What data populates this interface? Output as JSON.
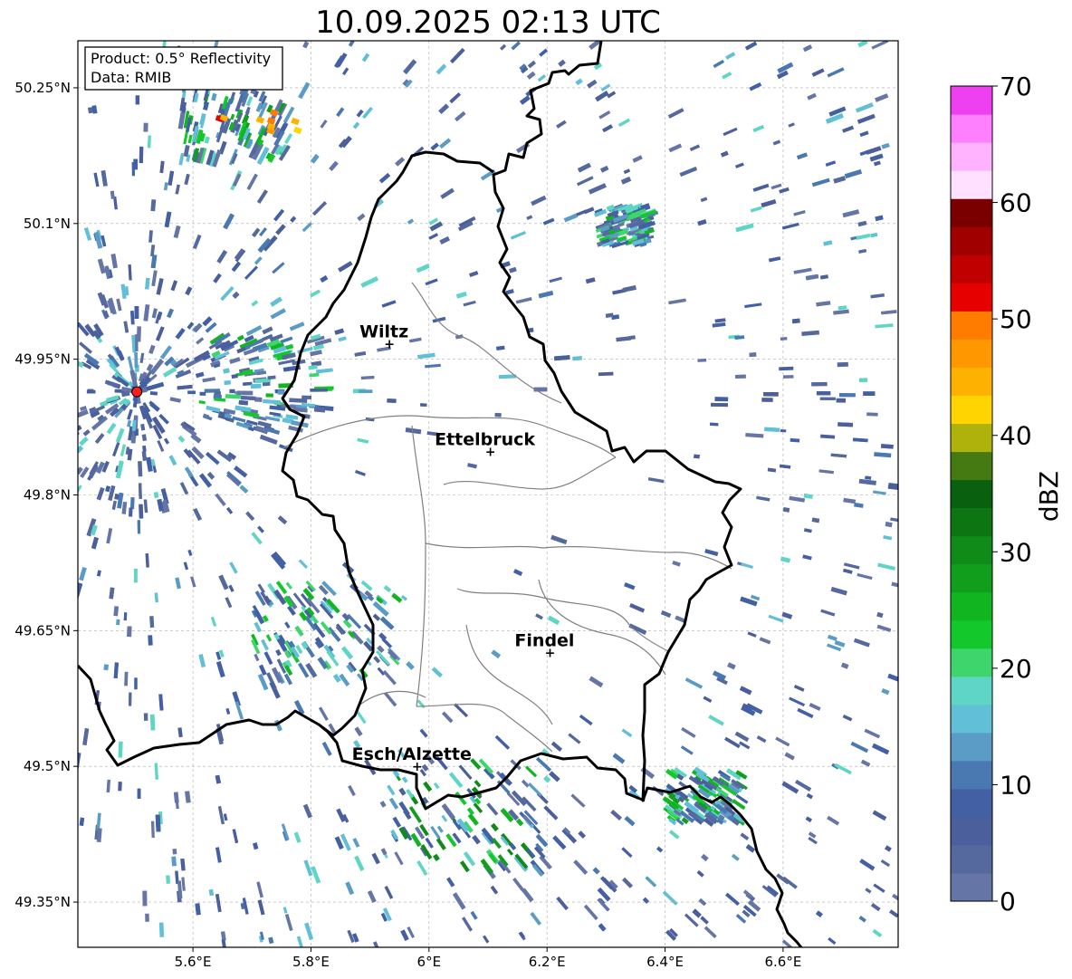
{
  "title": "10.09.2025 02:13 UTC",
  "info_box": {
    "product_line": "Product: 0.5° Reflectivity",
    "data_line": "Data: RMIB"
  },
  "x_ticks": [
    "5.6°E",
    "5.8°E",
    "6°E",
    "6.2°E",
    "6.4°E",
    "6.6°E"
  ],
  "x_tick_values": [
    5.6,
    5.8,
    6.0,
    6.2,
    6.4,
    6.6
  ],
  "y_ticks": [
    "50.25°N",
    "50.1°N",
    "49.95°N",
    "49.8°N",
    "49.65°N",
    "49.5°N",
    "49.35°N"
  ],
  "y_tick_values": [
    50.25,
    50.1,
    49.95,
    49.8,
    49.65,
    49.5,
    49.35
  ],
  "lon_range": [
    5.405,
    6.795
  ],
  "lat_range": [
    49.3,
    50.302
  ],
  "radar_site": {
    "lon": 5.505,
    "lat": 49.914,
    "color": "#ff1f1f"
  },
  "cities": [
    {
      "name": "Wiltz",
      "lon": 5.933,
      "lat": 49.967
    },
    {
      "name": "Ettelbruck",
      "lon": 6.104,
      "lat": 49.848
    },
    {
      "name": "Findel",
      "lon": 6.205,
      "lat": 49.626
    },
    {
      "name": "Esch/Alzette",
      "lon": 5.98,
      "lat": 49.5
    }
  ],
  "colorbar": {
    "label": "dBZ",
    "min": 0,
    "max": 70,
    "tick_labels": [
      "0",
      "10",
      "20",
      "30",
      "40",
      "50",
      "60",
      "70"
    ],
    "tick_values": [
      0,
      10,
      20,
      30,
      40,
      50,
      60,
      70
    ],
    "colors": [
      "#6475a6",
      "#55699e",
      "#4a5f9b",
      "#4460a5",
      "#4a78b0",
      "#5a9cc6",
      "#62bfd8",
      "#5fd6c5",
      "#3ed66c",
      "#12c82a",
      "#10b520",
      "#109e1c",
      "#108a18",
      "#0d7613",
      "#09600e",
      "#457a12",
      "#afb20a",
      "#ffd400",
      "#ffb100",
      "#ff9800",
      "#ff7c00",
      "#e60000",
      "#c00000",
      "#a00000",
      "#7a0000",
      "#ffe0ff",
      "#ffb3ff",
      "#ff80ff",
      "#ee3ff0"
    ]
  },
  "gridlines": true,
  "legend_placement": "top-left"
}
